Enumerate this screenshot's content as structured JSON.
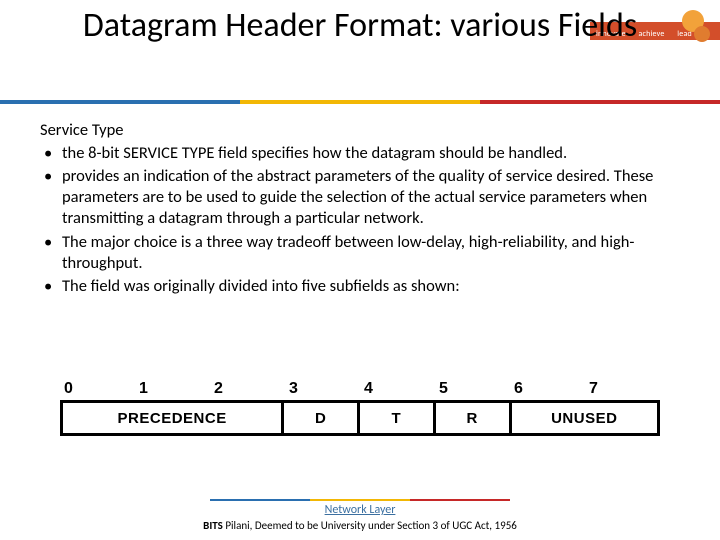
{
  "logo": {
    "words": [
      "innovate",
      "achieve",
      "lead"
    ]
  },
  "title": "Datagram Header Format: various Fields",
  "subhead": "Service Type",
  "bullets": [
    "the 8-bit SERVICE TYPE field  specifies how  the  datagram should  be handled.",
    "provides an indication of the abstract parameters of the quality of service desired. These parameters are to be used to guide the selection of the actual service parameters when transmitting a datagram through a particular network.",
    "The major choice is a three way tradeoff between low-delay, high-reliability, and high-throughput.",
    "The  field was  originally divided  into  five  subfields as shown:"
  ],
  "diagram": {
    "bits": [
      "0",
      "1",
      "2",
      "3",
      "4",
      "5",
      "6",
      "7"
    ],
    "fields": [
      {
        "label": "PRECEDENCE",
        "span": 3
      },
      {
        "label": "D",
        "span": 1
      },
      {
        "label": "T",
        "span": 1
      },
      {
        "label": "R",
        "span": 1
      },
      {
        "label": "UNUSED",
        "span": 2
      }
    ]
  },
  "footer": {
    "link": "Network Layer",
    "credit_bold": "BITS",
    "credit_rest": " Pilani, Deemed to be University under Section 3 of UGC Act, 1956"
  }
}
